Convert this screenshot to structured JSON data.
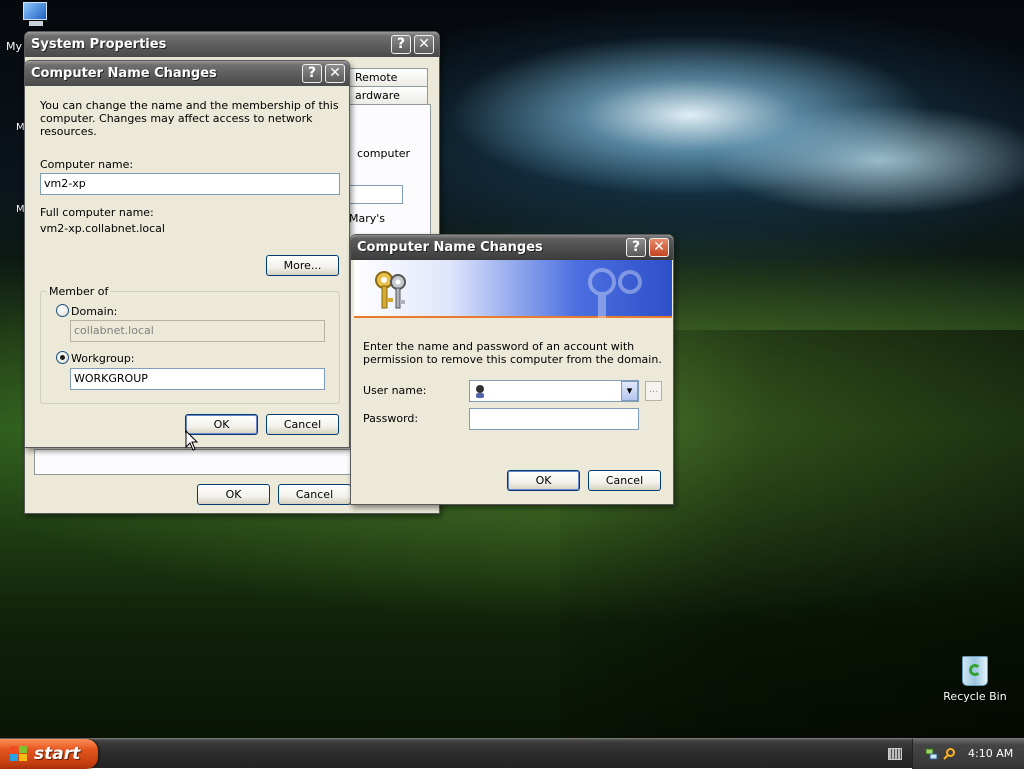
{
  "desktop": {
    "mycomputer_label": "My",
    "edge_label_1": "M",
    "edge_label_2": "M",
    "recycle_label": "Recycle Bin"
  },
  "system_properties": {
    "title": "System Properties",
    "help_glyph": "?",
    "close_glyph": "✕",
    "tabs": [
      "Remote",
      "ardware"
    ],
    "text_computer": "computer",
    "text_marys": "Mary's",
    "ok_label": "OK",
    "cancel_label": "Cancel"
  },
  "name_changes": {
    "title": "Computer Name Changes",
    "help_glyph": "?",
    "close_glyph": "✕",
    "intro_text": "You can change the name and the membership of this computer. Changes may affect access to network resources.",
    "computer_name_label": "Computer name:",
    "computer_name_value": "vm2-xp",
    "full_name_label": "Full computer name:",
    "full_name_value": "vm2-xp.collabnet.local",
    "more_label": "More...",
    "member_of_label": "Member of",
    "domain_label": "Domain:",
    "domain_value": "collabnet.local",
    "workgroup_label": "Workgroup:",
    "workgroup_value": "WORKGROUP",
    "ok_label": "OK",
    "cancel_label": "Cancel"
  },
  "credentials": {
    "title": "Computer Name Changes",
    "help_glyph": "?",
    "close_glyph": "✕",
    "prompt_text": "Enter the name and password of an account with permission to remove this computer from the domain.",
    "username_label": "User name:",
    "username_value": "",
    "password_label": "Password:",
    "password_value": "",
    "browse_glyph": "...",
    "dropdown_glyph": "▾",
    "ok_label": "OK",
    "cancel_label": "Cancel"
  },
  "taskbar": {
    "start_label": "start",
    "clock": "4:10 AM"
  },
  "icons": {
    "my_computer": "my-computer-icon",
    "recycle_bin": "recycle-bin-icon",
    "keys": "keys-icon",
    "user": "user-icon",
    "start_flag": "windows-flag-icon"
  }
}
